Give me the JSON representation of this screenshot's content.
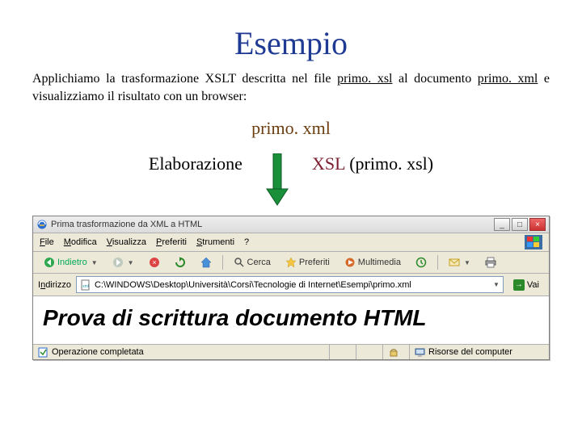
{
  "title": "Esempio",
  "body_parts": {
    "p1a": "Applichiamo la trasformazione XSLT descritta nel file ",
    "link1": "primo. xsl",
    "p1b": " al documento ",
    "link2": "primo. xml",
    "p1c": " e visualizziamo il risultato con un browser:"
  },
  "input_file": "primo. xml",
  "elaborazione": "Elaborazione",
  "xsl_label": "XSL",
  "xsl_file": "(primo. xsl)",
  "browser": {
    "window_title": "Prima trasformazione da XML a HTML",
    "menu": {
      "file": "File",
      "modifica": "Modifica",
      "visualizza": "Visualizza",
      "preferiti": "Preferiti",
      "strumenti": "Strumenti",
      "help": "?"
    },
    "toolbar": {
      "back": "Indietro",
      "search": "Cerca",
      "favorites": "Preferiti",
      "multimedia": "Multimedia"
    },
    "address_label": "Indirizzo",
    "address_value": "C:\\WINDOWS\\Desktop\\Università\\Corsi\\Tecnologie di Internet\\Esempi\\primo.xml",
    "go_label": "Vai",
    "page_heading": "Prova di scrittura documento HTML",
    "status_done": "Operazione completata",
    "status_zone": "Risorse del computer"
  }
}
